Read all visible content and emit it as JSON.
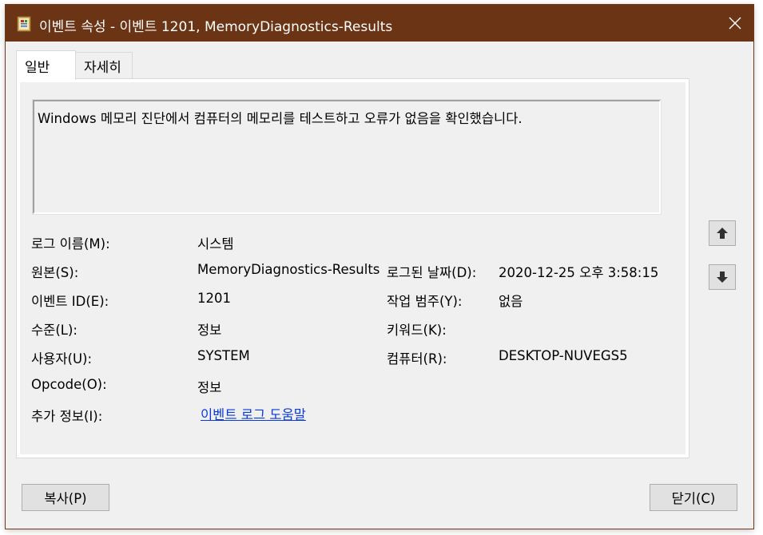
{
  "window": {
    "title": "이벤트 속성 - 이벤트 1201, MemoryDiagnostics-Results",
    "title_bar_color": "#6b3515",
    "icon": "event-viewer-icon"
  },
  "tabs": [
    {
      "label": "일반",
      "active": true
    },
    {
      "label": "자세히",
      "active": false
    }
  ],
  "description": "Windows 메모리 진단에서 컴퓨터의 메모리를 테스트하고 오류가 없음을 확인했습니다.",
  "fields": {
    "log_name": {
      "label": "로그 이름(M):",
      "value": "시스템"
    },
    "source": {
      "label": "원본(S):",
      "value": "MemoryDiagnostics-Results"
    },
    "logged": {
      "label": "로그된 날짜(D):",
      "value": "2020-12-25 오후 3:58:15"
    },
    "event_id": {
      "label": "이벤트 ID(E):",
      "value": "1201"
    },
    "task_category": {
      "label": "작업 범주(Y):",
      "value": "없음"
    },
    "level": {
      "label": "수준(L):",
      "value": "정보"
    },
    "keywords": {
      "label": "키워드(K):",
      "value": ""
    },
    "user": {
      "label": "사용자(U):",
      "value": "SYSTEM"
    },
    "computer": {
      "label": "컴퓨터(R):",
      "value": "DESKTOP-NUVEGS5"
    },
    "opcode": {
      "label": "Opcode(O):",
      "value": "정보"
    },
    "more_info": {
      "label": "추가 정보(I):",
      "link": "이벤트 로그 도움말"
    }
  },
  "nav": {
    "up_icon": "arrow-up-icon",
    "down_icon": "arrow-down-icon"
  },
  "buttons": {
    "copy": "복사(P)",
    "close": "닫기(C)"
  },
  "link_color": "#0b3ad6"
}
